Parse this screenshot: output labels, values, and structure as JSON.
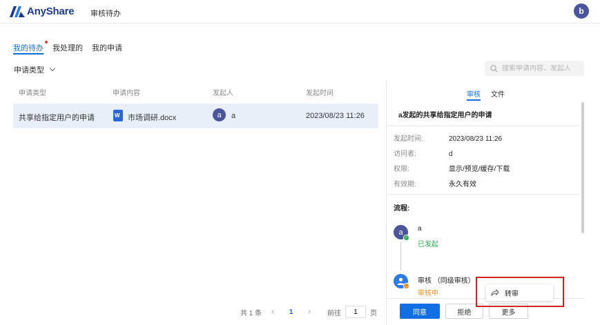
{
  "app": {
    "brand": "AnyShare",
    "page_title": "审核待办",
    "user_avatar": "b"
  },
  "tabs": [
    {
      "label": "我的待办",
      "active": true,
      "has_dot": true
    },
    {
      "label": "我处理的",
      "active": false
    },
    {
      "label": "我的申请",
      "active": false
    }
  ],
  "filter": {
    "label": "申请类型"
  },
  "search": {
    "placeholder": "搜索申请内容、发起人"
  },
  "table": {
    "columns": [
      "申请类型",
      "申请内容",
      "发起人",
      "发起时间"
    ],
    "rows": [
      {
        "type": "共享给指定用户的申请",
        "content": "市场调研.docx",
        "initiator_avatar": "a",
        "initiator": "a",
        "time": "2023/08/23 11:26"
      }
    ]
  },
  "pagination": {
    "total": "共 1 条",
    "current": "1",
    "goto_label": "前往",
    "goto_value": "1",
    "page_unit": "页"
  },
  "detail_panel": {
    "tabs": [
      "审核",
      "文件"
    ],
    "title": "a发起的共享给指定用户的申请",
    "fields": [
      {
        "label": "发起时间:",
        "value": "2023/08/23 11:26"
      },
      {
        "label": "访问者:",
        "value": "d"
      },
      {
        "label": "权限:",
        "value": "显示/预览/缓存/下载"
      },
      {
        "label": "有效期:",
        "value": "永久有效"
      }
    ],
    "flow_title": "流程:",
    "steps": [
      {
        "avatar": "a",
        "name": "a",
        "status": "已发起",
        "status_color": "#27a84a"
      },
      {
        "name": "审核 （同级审核）",
        "status": "审核中",
        "status_color": "#f08c1a"
      }
    ]
  },
  "actions": {
    "approve": "同意",
    "reject": "拒绝",
    "more": "更多"
  },
  "more_menu": {
    "items": [
      "转审"
    ]
  },
  "colors": {
    "primary": "#126ee3",
    "avatar": "#4a5699",
    "highlight": "#d6221e"
  }
}
